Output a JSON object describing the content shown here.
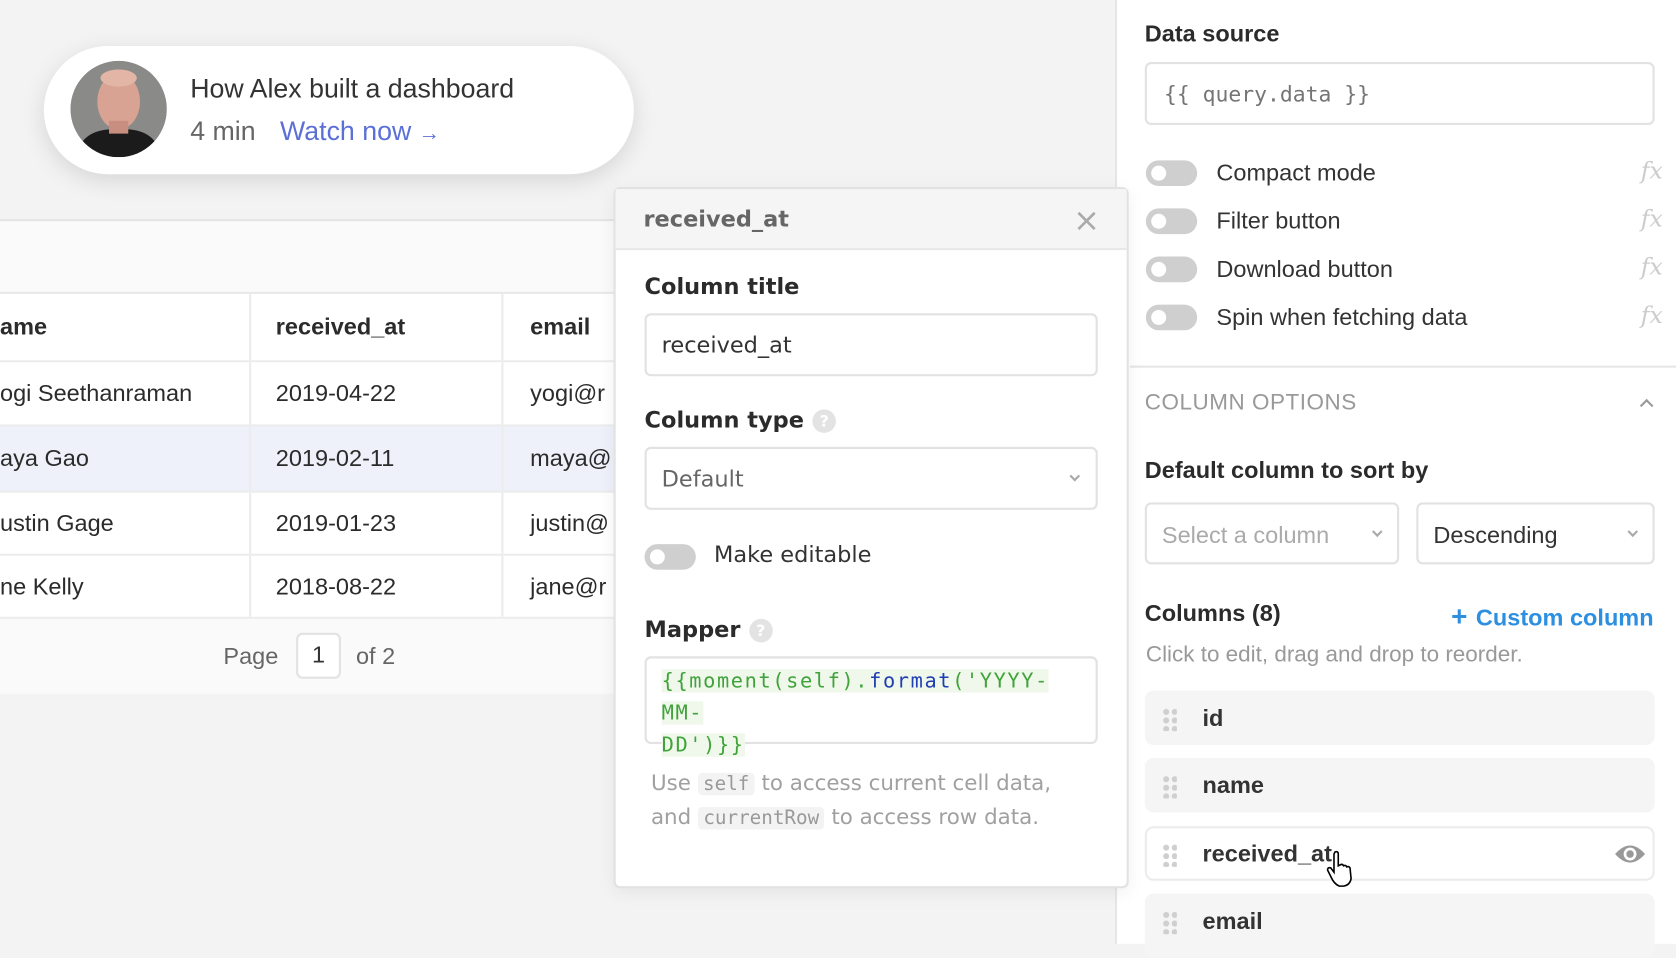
{
  "video": {
    "title": "How Alex built a dashboard",
    "duration": "4 min",
    "watch_label": "Watch now",
    "arrow": "→"
  },
  "table": {
    "columns": [
      "ame",
      "received_at",
      "email"
    ],
    "rows": [
      [
        "ogi Seethanraman",
        "2019-04-22",
        "yogi@r"
      ],
      [
        "aya Gao",
        "2019-02-11",
        "maya@"
      ],
      [
        "ustin Gage",
        "2019-01-23",
        "justin@"
      ],
      [
        "ne Kelly",
        "2018-08-22",
        "jane@r"
      ]
    ],
    "selected_row": 1,
    "pager": {
      "page_label": "Page",
      "page": "1",
      "of_label": "of 2"
    }
  },
  "modal": {
    "title": "received_at",
    "close": "×",
    "column_title_label": "Column title",
    "column_title_value": "received_at",
    "column_type_label": "Column type",
    "column_type_value": "Default",
    "help": "?",
    "make_editable_label": "Make editable",
    "make_editable_on": false,
    "mapper_label": "Mapper",
    "mapper": {
      "p1": "{{moment(self).",
      "p2": "format",
      "p3": "('YYYY-MM-",
      "p4": "DD')}}"
    },
    "hint": {
      "a": "Use",
      "code1": "self",
      "b": "to access current cell data,",
      "c": "and",
      "code2": "currentRow",
      "d": "to access row data."
    }
  },
  "panel": {
    "data_source_label": "Data source",
    "data_source_placeholder": "{{ query.data }}",
    "fx": "fx",
    "toggles": [
      {
        "label": "Compact mode",
        "on": false
      },
      {
        "label": "Filter button",
        "on": false
      },
      {
        "label": "Download button",
        "on": false
      },
      {
        "label": "Spin when fetching data",
        "on": false
      }
    ],
    "column_options_label": "COLUMN OPTIONS",
    "sort_label": "Default column to sort by",
    "sort_column_placeholder": "Select a column",
    "sort_direction": "Descending",
    "columns_label": "Columns (8)",
    "custom_column_label": "Custom column",
    "custom_plus": "+",
    "columns_hint": "Click to edit, drag and drop to reorder.",
    "columns": [
      "id",
      "name",
      "received_at",
      "email"
    ],
    "accent": "#2d8fe0"
  }
}
